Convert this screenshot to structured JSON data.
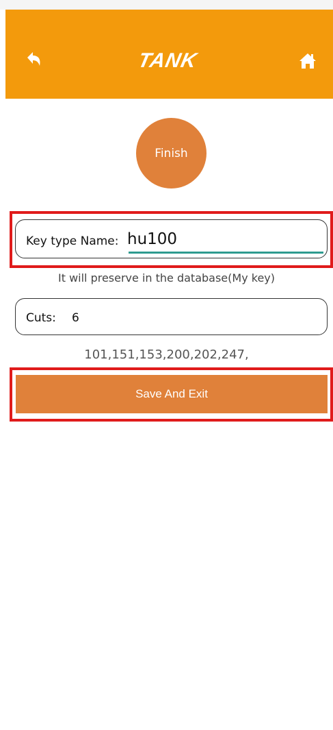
{
  "header": {
    "logo_text": "TANK",
    "back_icon": "undo-arrow-icon",
    "home_icon": "home-icon",
    "bar_color": "#f39a0c"
  },
  "finish_button": {
    "label": "Finish",
    "color": "#e0813a"
  },
  "key_type": {
    "label": "Key type Name:",
    "value": "hu100"
  },
  "hint_text": "It will preserve in the database(My key)",
  "cuts": {
    "label": "Cuts:",
    "value": "6"
  },
  "cut_values": "101,151,153,200,202,247,",
  "save_button": {
    "label": "Save And Exit"
  },
  "highlight_color": "#e01b1b"
}
